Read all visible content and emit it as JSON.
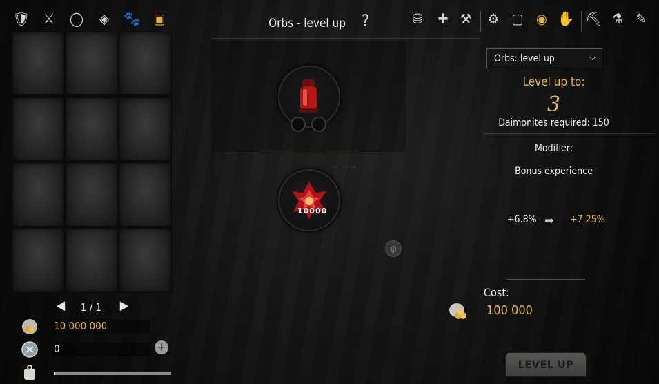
{
  "header": {
    "title": "Orbs - level up",
    "help": "?"
  },
  "left_tabs": [
    {
      "icon": "armor-icon",
      "glyph": "🛡"
    },
    {
      "icon": "sword-icon",
      "glyph": "⚔"
    },
    {
      "icon": "ring-icon",
      "glyph": "◯"
    },
    {
      "icon": "amulet-icon",
      "glyph": "◈"
    },
    {
      "icon": "paw-icon",
      "glyph": "🐾"
    },
    {
      "icon": "chest-icon",
      "glyph": "▣"
    }
  ],
  "right_tabs": [
    {
      "icon": "coins-icon",
      "glyph": "⛁"
    },
    {
      "icon": "bag-plus-icon",
      "glyph": "✚"
    },
    {
      "icon": "anvil-icon",
      "glyph": "⚒"
    },
    {
      "icon": "craft-table-icon",
      "glyph": "⚙"
    },
    {
      "icon": "frame-icon",
      "glyph": "▢"
    },
    {
      "icon": "orb-ring-icon",
      "glyph": "◉"
    },
    {
      "icon": "hand-icon",
      "glyph": "✋"
    },
    {
      "icon": "pickaxe-icon",
      "glyph": "⛏"
    },
    {
      "icon": "flask-icon",
      "glyph": "⚗"
    },
    {
      "icon": "pen-icon",
      "glyph": "✎"
    }
  ],
  "inventory": {
    "slots": 12,
    "page_label": "1 / 1"
  },
  "currencies": {
    "gold_value": "10 000 000",
    "silver_value": "0",
    "weight_fill": 0.01
  },
  "orbs": {
    "upper_item": "red-vial-orb",
    "lower_count": "10000",
    "ghost_label": "... ... ..."
  },
  "right_panel": {
    "dropdown_value": "Orbs: level up",
    "level_up_to_label": "Level up to:",
    "level_value": "3",
    "daimonites": "Daimonites required: 150",
    "modifier_label": "Modifier:",
    "modifier_name": "Bonus experience",
    "stat_old": "+6.8%",
    "stat_new": "+7.25%",
    "cost_label": "Cost:",
    "cost_value": "100 000",
    "button_label": "LEVEL UP"
  },
  "colors": {
    "accent_gold": "#e6b54b"
  }
}
